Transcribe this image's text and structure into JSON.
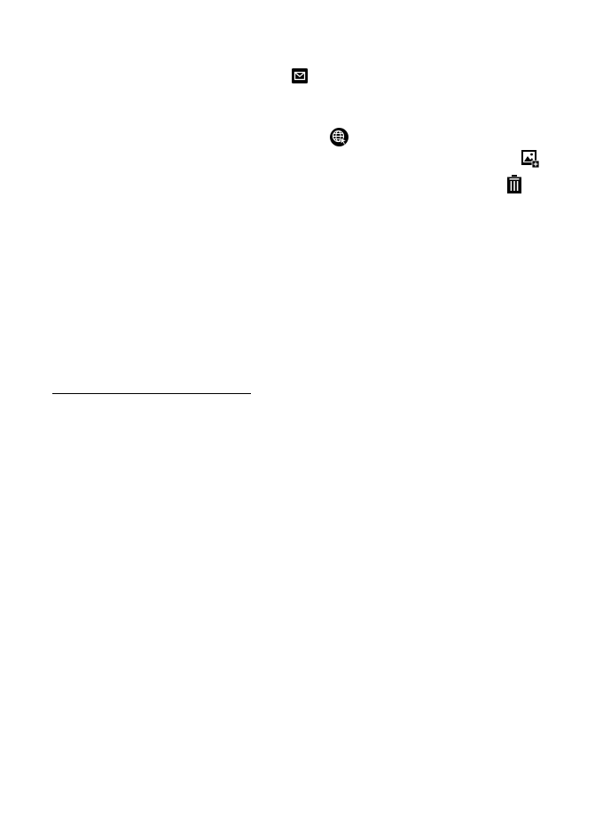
{
  "page": {
    "background_color": "#ffffff",
    "ink_color": "#000000"
  },
  "icons": [
    {
      "name": "mail-icon"
    },
    {
      "name": "globe-icon"
    },
    {
      "name": "image-add-icon"
    },
    {
      "name": "trash-icon"
    }
  ],
  "footnote_rule": {
    "color": "#000000"
  }
}
